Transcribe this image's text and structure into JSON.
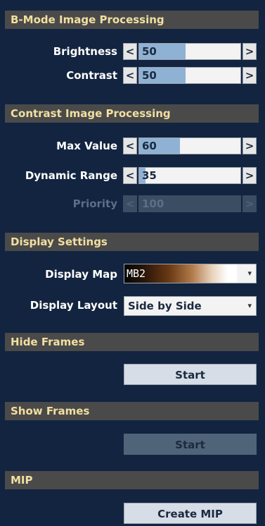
{
  "sections": {
    "bmode": {
      "title": "B-Mode Image Processing"
    },
    "contrast": {
      "title": "Contrast Image Processing"
    },
    "display": {
      "title": "Display Settings"
    },
    "hide": {
      "title": "Hide Frames"
    },
    "show": {
      "title": "Show Frames"
    },
    "mip": {
      "title": "MIP"
    }
  },
  "sliders": {
    "brightness": {
      "label": "Brightness",
      "value": "50",
      "fill_percent": 46
    },
    "contrast": {
      "label": "Contrast",
      "value": "50",
      "fill_percent": 46
    },
    "max_value": {
      "label": "Max Value",
      "value": "60",
      "fill_percent": 40
    },
    "dynamic_range": {
      "label": "Dynamic Range",
      "value": "35",
      "fill_percent": 6
    },
    "priority": {
      "label": "Priority",
      "value": "100",
      "fill_percent": 100,
      "disabled": true
    }
  },
  "arrows": {
    "left": "<",
    "right": ">"
  },
  "display_map": {
    "label": "Display Map",
    "value": "MB2"
  },
  "display_layout": {
    "label": "Display Layout",
    "value": "Side by Side"
  },
  "caret": "▾",
  "hide_frames_button": {
    "label": "Start"
  },
  "show_frames_button": {
    "label": "Start",
    "disabled": true
  },
  "mip_button": {
    "label": "Create MIP"
  },
  "colors": {
    "background": "#12243f",
    "header_bg": "#4a4a4a",
    "header_text": "#f2dfa0",
    "slider_fill": "#8fb2d4"
  }
}
